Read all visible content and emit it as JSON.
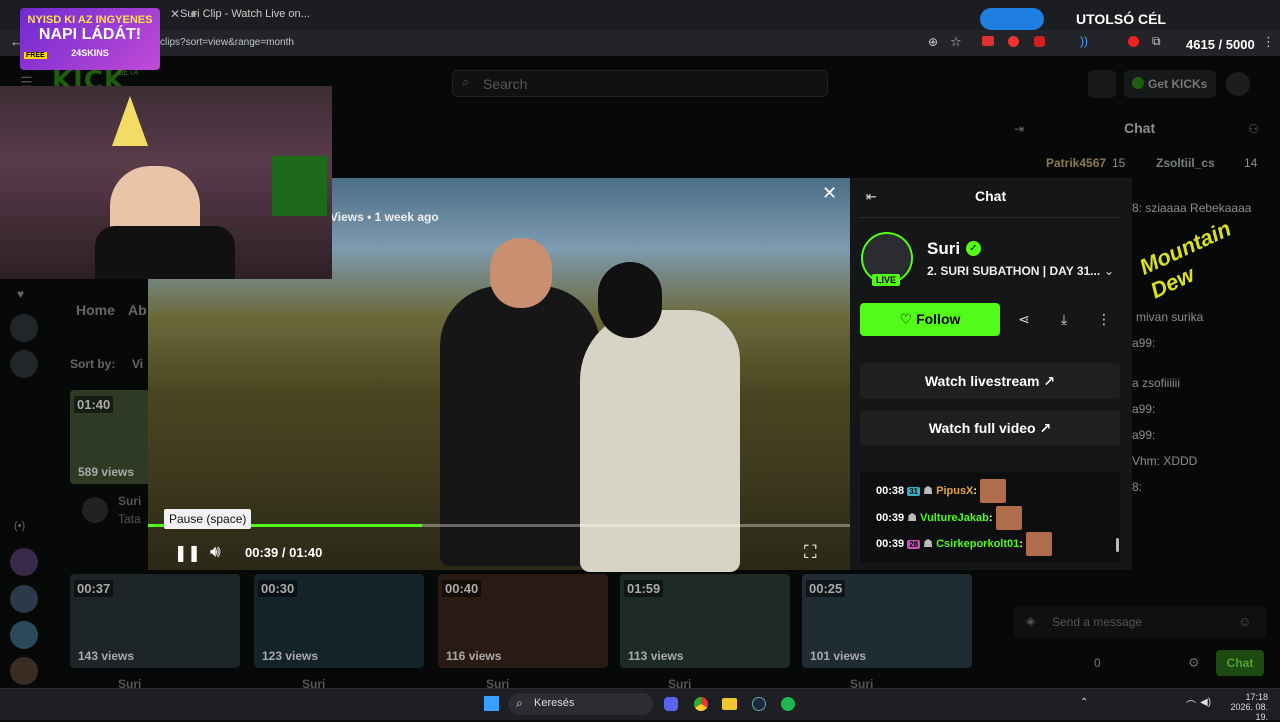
{
  "browser": {
    "tab_title": "Suri Clip - Watch Live on...",
    "url": "clips?sort=view&range=month"
  },
  "site": {
    "logo": "KICK",
    "logo_badge": "BETA",
    "search_placeholder": "Search",
    "get_kicks_label": "Get KICKs",
    "nav_home": "Home",
    "nav_about": "Ab",
    "sort_label": "Sort by:",
    "sort_value": "Vi"
  },
  "background_chat": {
    "title": "Chat",
    "top_users": [
      {
        "name": "Patrik4567",
        "count": "15"
      },
      {
        "name": "Zsoltiil_cs",
        "count": "14"
      }
    ],
    "lines": [
      "8: sziaaaa Rebekaaaa",
      "mivan surika",
      "a99:",
      "a zsofiiiiii",
      "a99:",
      "a99:",
      "Vhm: XDDD",
      "8:"
    ],
    "message_placeholder": "Send a message",
    "kicks_count": "0",
    "chat_button": "Chat"
  },
  "background_clips": [
    {
      "duration": "01:40",
      "views": "589 views",
      "channel": "Suri",
      "title": "Tata"
    },
    {
      "duration": "00:37",
      "views": "143 views",
      "channel": "Suri"
    },
    {
      "duration": "00:30",
      "views": "123 views",
      "channel": "Suri"
    },
    {
      "duration": "00:40",
      "views": "116 views",
      "channel": "Suri"
    },
    {
      "duration": "01:59",
      "views": "113 views",
      "channel": "Suri"
    },
    {
      "duration": "00:25",
      "views": "101 views",
      "channel": "Suri"
    }
  ],
  "player": {
    "views_line": "Views • 1 week ago",
    "tooltip": "Pause (space)",
    "time": "00:39 / 01:40",
    "progress": 0.39
  },
  "panel": {
    "chat_title": "Chat",
    "channel_name": "Suri",
    "live_badge": "LIVE",
    "stream_title": "2. SURI SUBATHON | DAY 31...",
    "follow_label": "Follow",
    "watch_livestream": "Watch livestream",
    "watch_full_video": "Watch full video",
    "messages": [
      {
        "time": "00:38",
        "badge": "31",
        "user": "PipusX",
        "color": "#e6a33a"
      },
      {
        "time": "00:39",
        "badge": "",
        "user": "VultureJakab",
        "color": "#53fc18"
      },
      {
        "time": "00:39",
        "badge": "28",
        "user": "Csirkeporkolt01",
        "color": "#53fc18"
      }
    ]
  },
  "overlay": {
    "ad_line1": "NYISD KI AZ INGYENES",
    "ad_line2": "NAPI LÁDÁT!",
    "ad_footer": "24SKINS",
    "ad_badge": "FREE",
    "goal_label": "UTOLSÓ CÉL",
    "goal_count": "4615 / 5000",
    "dew_logo": "Mountain Dew"
  },
  "taskbar": {
    "search": "Keresés",
    "time": "17:18",
    "date": "2026. 08. 19."
  }
}
